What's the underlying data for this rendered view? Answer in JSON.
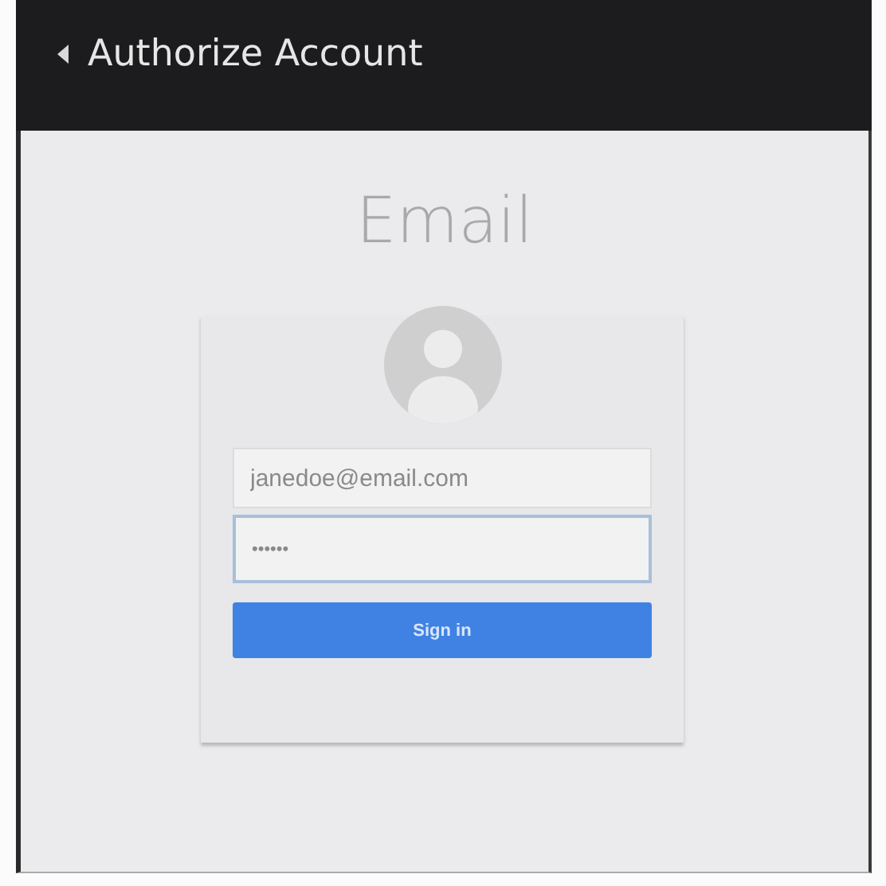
{
  "header": {
    "title": "Authorize Account"
  },
  "page_title": "Email",
  "form": {
    "fields": [
      {
        "value": "janedoe@email.com",
        "focused": false
      },
      {
        "value": "••••••",
        "focused": true
      }
    ],
    "button": "Sign in"
  }
}
